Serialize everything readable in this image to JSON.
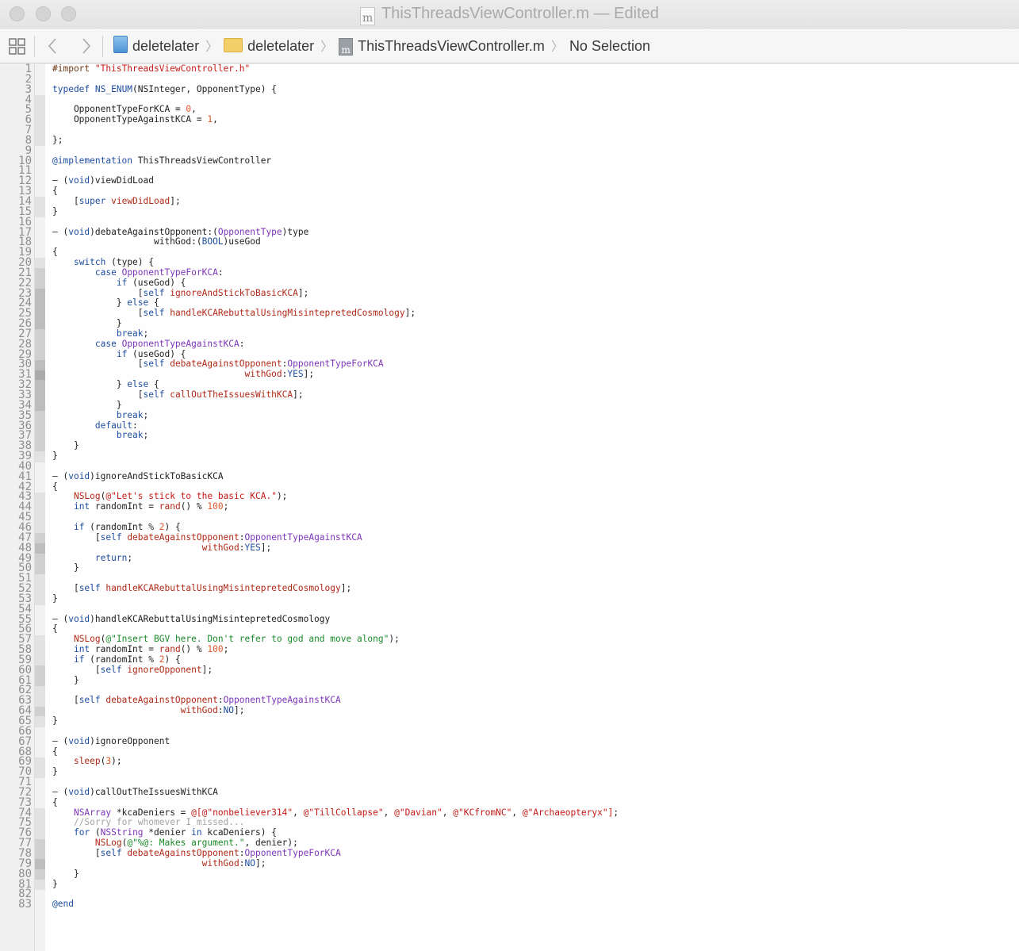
{
  "window": {
    "title": "ThisThreadsViewController.m",
    "separator": "—",
    "status": "Edited",
    "file_icon_glyph": "m"
  },
  "toolbar": {
    "related_items_icon": "grid-icon",
    "back_icon": "chevron-left-icon",
    "forward_icon": "chevron-right-icon"
  },
  "jumpbar": {
    "project": "deletelater",
    "group": "deletelater",
    "file": "ThisThreadsViewController.m",
    "selection": "No Selection",
    "file_icon_glyph": "m"
  },
  "colors": {
    "keyword": "#b4247f",
    "keyword_blue": "#1f4fa0",
    "string": "#c41a16",
    "method": "#b02a18",
    "type": "#7d35b8",
    "number": "#e0572a",
    "comment": "#a3a3a3"
  },
  "editor": {
    "lines": [
      [
        [
          "dir",
          "#import "
        ],
        [
          "str",
          "\"ThisThreadsViewController.h\""
        ]
      ],
      [],
      [
        [
          "blue",
          "typedef "
        ],
        [
          "blue",
          "NS_ENUM"
        ],
        [
          "",
          "(NSInteger, OpponentType) {"
        ]
      ],
      [],
      [
        [
          "",
          "    OpponentTypeForKCA = "
        ],
        [
          "num",
          "0"
        ],
        [
          "",
          ","
        ]
      ],
      [
        [
          "",
          "    OpponentTypeAgainstKCA = "
        ],
        [
          "num",
          "1"
        ],
        [
          "",
          ","
        ]
      ],
      [],
      [
        [
          "",
          "};"
        ]
      ],
      [],
      [
        [
          "blue",
          "@implementation "
        ],
        [
          "",
          "ThisThreadsViewController"
        ]
      ],
      [],
      [
        [
          "",
          "– ("
        ],
        [
          "blue",
          "void"
        ],
        [
          "",
          ")viewDidLoad"
        ]
      ],
      [
        [
          "",
          "{"
        ]
      ],
      [
        [
          "",
          "    ["
        ],
        [
          "blue",
          "super "
        ],
        [
          "meth",
          "viewDidLoad"
        ],
        [
          "",
          "];"
        ]
      ],
      [
        [
          "",
          "}"
        ]
      ],
      [],
      [
        [
          "",
          "– ("
        ],
        [
          "blue",
          "void"
        ],
        [
          "",
          ")debateAgainstOpponent:("
        ],
        [
          "type",
          "OpponentType"
        ],
        [
          "",
          ")type"
        ]
      ],
      [
        [
          "",
          "                   withGod:("
        ],
        [
          "blue",
          "BOOL"
        ],
        [
          "",
          ")useGod"
        ]
      ],
      [
        [
          "",
          "{"
        ]
      ],
      [
        [
          "",
          "    "
        ],
        [
          "blue",
          "switch "
        ],
        [
          "",
          "(type) {"
        ]
      ],
      [
        [
          "",
          "        "
        ],
        [
          "blue",
          "case "
        ],
        [
          "type",
          "OpponentTypeForKCA"
        ],
        [
          "",
          ":"
        ]
      ],
      [
        [
          "",
          "            "
        ],
        [
          "blue",
          "if "
        ],
        [
          "",
          "(useGod) {"
        ]
      ],
      [
        [
          "",
          "                ["
        ],
        [
          "blue",
          "self "
        ],
        [
          "meth",
          "ignoreAndStickToBasicKCA"
        ],
        [
          "",
          "];"
        ]
      ],
      [
        [
          "",
          "            } "
        ],
        [
          "blue",
          "else "
        ],
        [
          "",
          "{"
        ]
      ],
      [
        [
          "",
          "                ["
        ],
        [
          "blue",
          "self "
        ],
        [
          "meth",
          "handleKCARebuttalUsingMisintepretedCosmology"
        ],
        [
          "",
          "];"
        ]
      ],
      [
        [
          "",
          "            }"
        ]
      ],
      [
        [
          "",
          "            "
        ],
        [
          "blue",
          "break"
        ],
        [
          "",
          ";"
        ]
      ],
      [
        [
          "",
          "        "
        ],
        [
          "blue",
          "case "
        ],
        [
          "type",
          "OpponentTypeAgainstKCA"
        ],
        [
          "",
          ":"
        ]
      ],
      [
        [
          "",
          "            "
        ],
        [
          "blue",
          "if "
        ],
        [
          "",
          "(useGod) {"
        ]
      ],
      [
        [
          "",
          "                ["
        ],
        [
          "blue",
          "self "
        ],
        [
          "meth",
          "debateAgainstOpponent"
        ],
        [
          "",
          ":"
        ],
        [
          "type",
          "OpponentTypeForKCA"
        ]
      ],
      [
        [
          "",
          "                                    "
        ],
        [
          "meth",
          "withGod"
        ],
        [
          "",
          ":"
        ],
        [
          "blue",
          "YES"
        ],
        [
          "",
          "];"
        ]
      ],
      [
        [
          "",
          "            } "
        ],
        [
          "blue",
          "else "
        ],
        [
          "",
          "{"
        ]
      ],
      [
        [
          "",
          "                ["
        ],
        [
          "blue",
          "self "
        ],
        [
          "meth",
          "callOutTheIssuesWithKCA"
        ],
        [
          "",
          "];"
        ]
      ],
      [
        [
          "",
          "            }"
        ]
      ],
      [
        [
          "",
          "            "
        ],
        [
          "blue",
          "break"
        ],
        [
          "",
          ";"
        ]
      ],
      [
        [
          "",
          "        "
        ],
        [
          "blue",
          "default"
        ],
        [
          "",
          ":"
        ]
      ],
      [
        [
          "",
          "            "
        ],
        [
          "blue",
          "break"
        ],
        [
          "",
          ";"
        ]
      ],
      [
        [
          "",
          "    }"
        ]
      ],
      [
        [
          "",
          "}"
        ]
      ],
      [],
      [
        [
          "",
          "– ("
        ],
        [
          "blue",
          "void"
        ],
        [
          "",
          ")ignoreAndStickToBasicKCA"
        ]
      ],
      [
        [
          "",
          "{"
        ]
      ],
      [
        [
          "",
          "    "
        ],
        [
          "meth",
          "NSLog"
        ],
        [
          "",
          "("
        ],
        [
          "str",
          "@\"Let's stick to the basic KCA.\""
        ],
        [
          "",
          ");"
        ]
      ],
      [
        [
          "",
          "    "
        ],
        [
          "blue",
          "int "
        ],
        [
          "",
          "randomInt = "
        ],
        [
          "meth",
          "rand"
        ],
        [
          "",
          "() % "
        ],
        [
          "num",
          "100"
        ],
        [
          "",
          ";"
        ]
      ],
      [],
      [
        [
          "",
          "    "
        ],
        [
          "blue",
          "if "
        ],
        [
          "",
          "(randomInt % "
        ],
        [
          "num",
          "2"
        ],
        [
          "",
          ") {"
        ]
      ],
      [
        [
          "",
          "        ["
        ],
        [
          "blue",
          "self "
        ],
        [
          "meth",
          "debateAgainstOpponent"
        ],
        [
          "",
          ":"
        ],
        [
          "type",
          "OpponentTypeAgainstKCA"
        ]
      ],
      [
        [
          "",
          "                            "
        ],
        [
          "meth",
          "withGod"
        ],
        [
          "",
          ":"
        ],
        [
          "blue",
          "YES"
        ],
        [
          "",
          "];"
        ]
      ],
      [
        [
          "",
          "        "
        ],
        [
          "blue",
          "return"
        ],
        [
          "",
          ";"
        ]
      ],
      [
        [
          "",
          "    }"
        ]
      ],
      [],
      [
        [
          "",
          "    ["
        ],
        [
          "blue",
          "self "
        ],
        [
          "meth",
          "handleKCARebuttalUsingMisintepretedCosmology"
        ],
        [
          "",
          "];"
        ]
      ],
      [
        [
          "",
          "}"
        ]
      ],
      [],
      [
        [
          "",
          "– ("
        ],
        [
          "blue",
          "void"
        ],
        [
          "",
          ")handleKCARebuttalUsingMisintepretedCosmology"
        ]
      ],
      [
        [
          "",
          "{"
        ]
      ],
      [
        [
          "",
          "    "
        ],
        [
          "meth",
          "NSLog"
        ],
        [
          "",
          "("
        ],
        [
          "mstr",
          "@\"Insert BGV here. Don't refer to god and move along\""
        ],
        [
          "",
          ");"
        ]
      ],
      [
        [
          "",
          "    "
        ],
        [
          "blue",
          "int "
        ],
        [
          "",
          "randomInt = "
        ],
        [
          "meth",
          "rand"
        ],
        [
          "",
          "() % "
        ],
        [
          "num",
          "100"
        ],
        [
          "",
          ";"
        ]
      ],
      [
        [
          "",
          "    "
        ],
        [
          "blue",
          "if "
        ],
        [
          "",
          "(randomInt % "
        ],
        [
          "num",
          "2"
        ],
        [
          "",
          ") {"
        ]
      ],
      [
        [
          "",
          "        ["
        ],
        [
          "blue",
          "self "
        ],
        [
          "meth",
          "ignoreOpponent"
        ],
        [
          "",
          "];"
        ]
      ],
      [
        [
          "",
          "    }"
        ]
      ],
      [],
      [
        [
          "",
          "    ["
        ],
        [
          "blue",
          "self "
        ],
        [
          "meth",
          "debateAgainstOpponent"
        ],
        [
          "",
          ":"
        ],
        [
          "type",
          "OpponentTypeAgainstKCA"
        ]
      ],
      [
        [
          "",
          "                        "
        ],
        [
          "meth",
          "withGod"
        ],
        [
          "",
          ":"
        ],
        [
          "blue",
          "NO"
        ],
        [
          "",
          "];"
        ]
      ],
      [
        [
          "",
          "}"
        ]
      ],
      [],
      [
        [
          "",
          "– ("
        ],
        [
          "blue",
          "void"
        ],
        [
          "",
          ")ignoreOpponent"
        ]
      ],
      [
        [
          "",
          "{"
        ]
      ],
      [
        [
          "",
          "    "
        ],
        [
          "meth",
          "sleep"
        ],
        [
          "",
          "("
        ],
        [
          "num",
          "3"
        ],
        [
          "",
          ");"
        ]
      ],
      [
        [
          "",
          "}"
        ]
      ],
      [],
      [
        [
          "",
          "– ("
        ],
        [
          "blue",
          "void"
        ],
        [
          "",
          ")callOutTheIssuesWithKCA"
        ]
      ],
      [
        [
          "",
          "{"
        ]
      ],
      [
        [
          "",
          "    "
        ],
        [
          "type",
          "NSArray "
        ],
        [
          "",
          "*kcaDeniers = "
        ],
        [
          "str",
          "@[@\"nonbeliever314\""
        ],
        [
          "",
          ", "
        ],
        [
          "str",
          "@\"TillCollapse\""
        ],
        [
          "",
          ", "
        ],
        [
          "str",
          "@\"Davian\""
        ],
        [
          "",
          ", "
        ],
        [
          "str",
          "@\"KCfromNC\""
        ],
        [
          "",
          ", "
        ],
        [
          "str",
          "@\"Archaeopteryx\""
        ],
        [
          "str",
          "]"
        ],
        [
          "",
          ";"
        ]
      ],
      [
        [
          "",
          "    "
        ],
        [
          "cmt",
          "//Sorry for whomever I missed..."
        ]
      ],
      [
        [
          "",
          "    "
        ],
        [
          "blue",
          "for "
        ],
        [
          "",
          "("
        ],
        [
          "type",
          "NSString "
        ],
        [
          "",
          "*denier "
        ],
        [
          "blue",
          "in "
        ],
        [
          "",
          "kcaDeniers) {"
        ]
      ],
      [
        [
          "",
          "        "
        ],
        [
          "meth",
          "NSLog"
        ],
        [
          "",
          "("
        ],
        [
          "mstr",
          "@\"%@: Makes argument.\""
        ],
        [
          "",
          ", denier);"
        ]
      ],
      [
        [
          "",
          "        ["
        ],
        [
          "blue",
          "self "
        ],
        [
          "meth",
          "debateAgainstOpponent"
        ],
        [
          "",
          ":"
        ],
        [
          "type",
          "OpponentTypeForKCA"
        ]
      ],
      [
        [
          "",
          "                            "
        ],
        [
          "meth",
          "withGod"
        ],
        [
          "",
          ":"
        ],
        [
          "blue",
          "NO"
        ],
        [
          "",
          "];"
        ]
      ],
      [
        [
          "",
          "    }"
        ]
      ],
      [
        [
          "",
          "}"
        ]
      ],
      [],
      [
        [
          "blue",
          "@end"
        ]
      ]
    ]
  }
}
